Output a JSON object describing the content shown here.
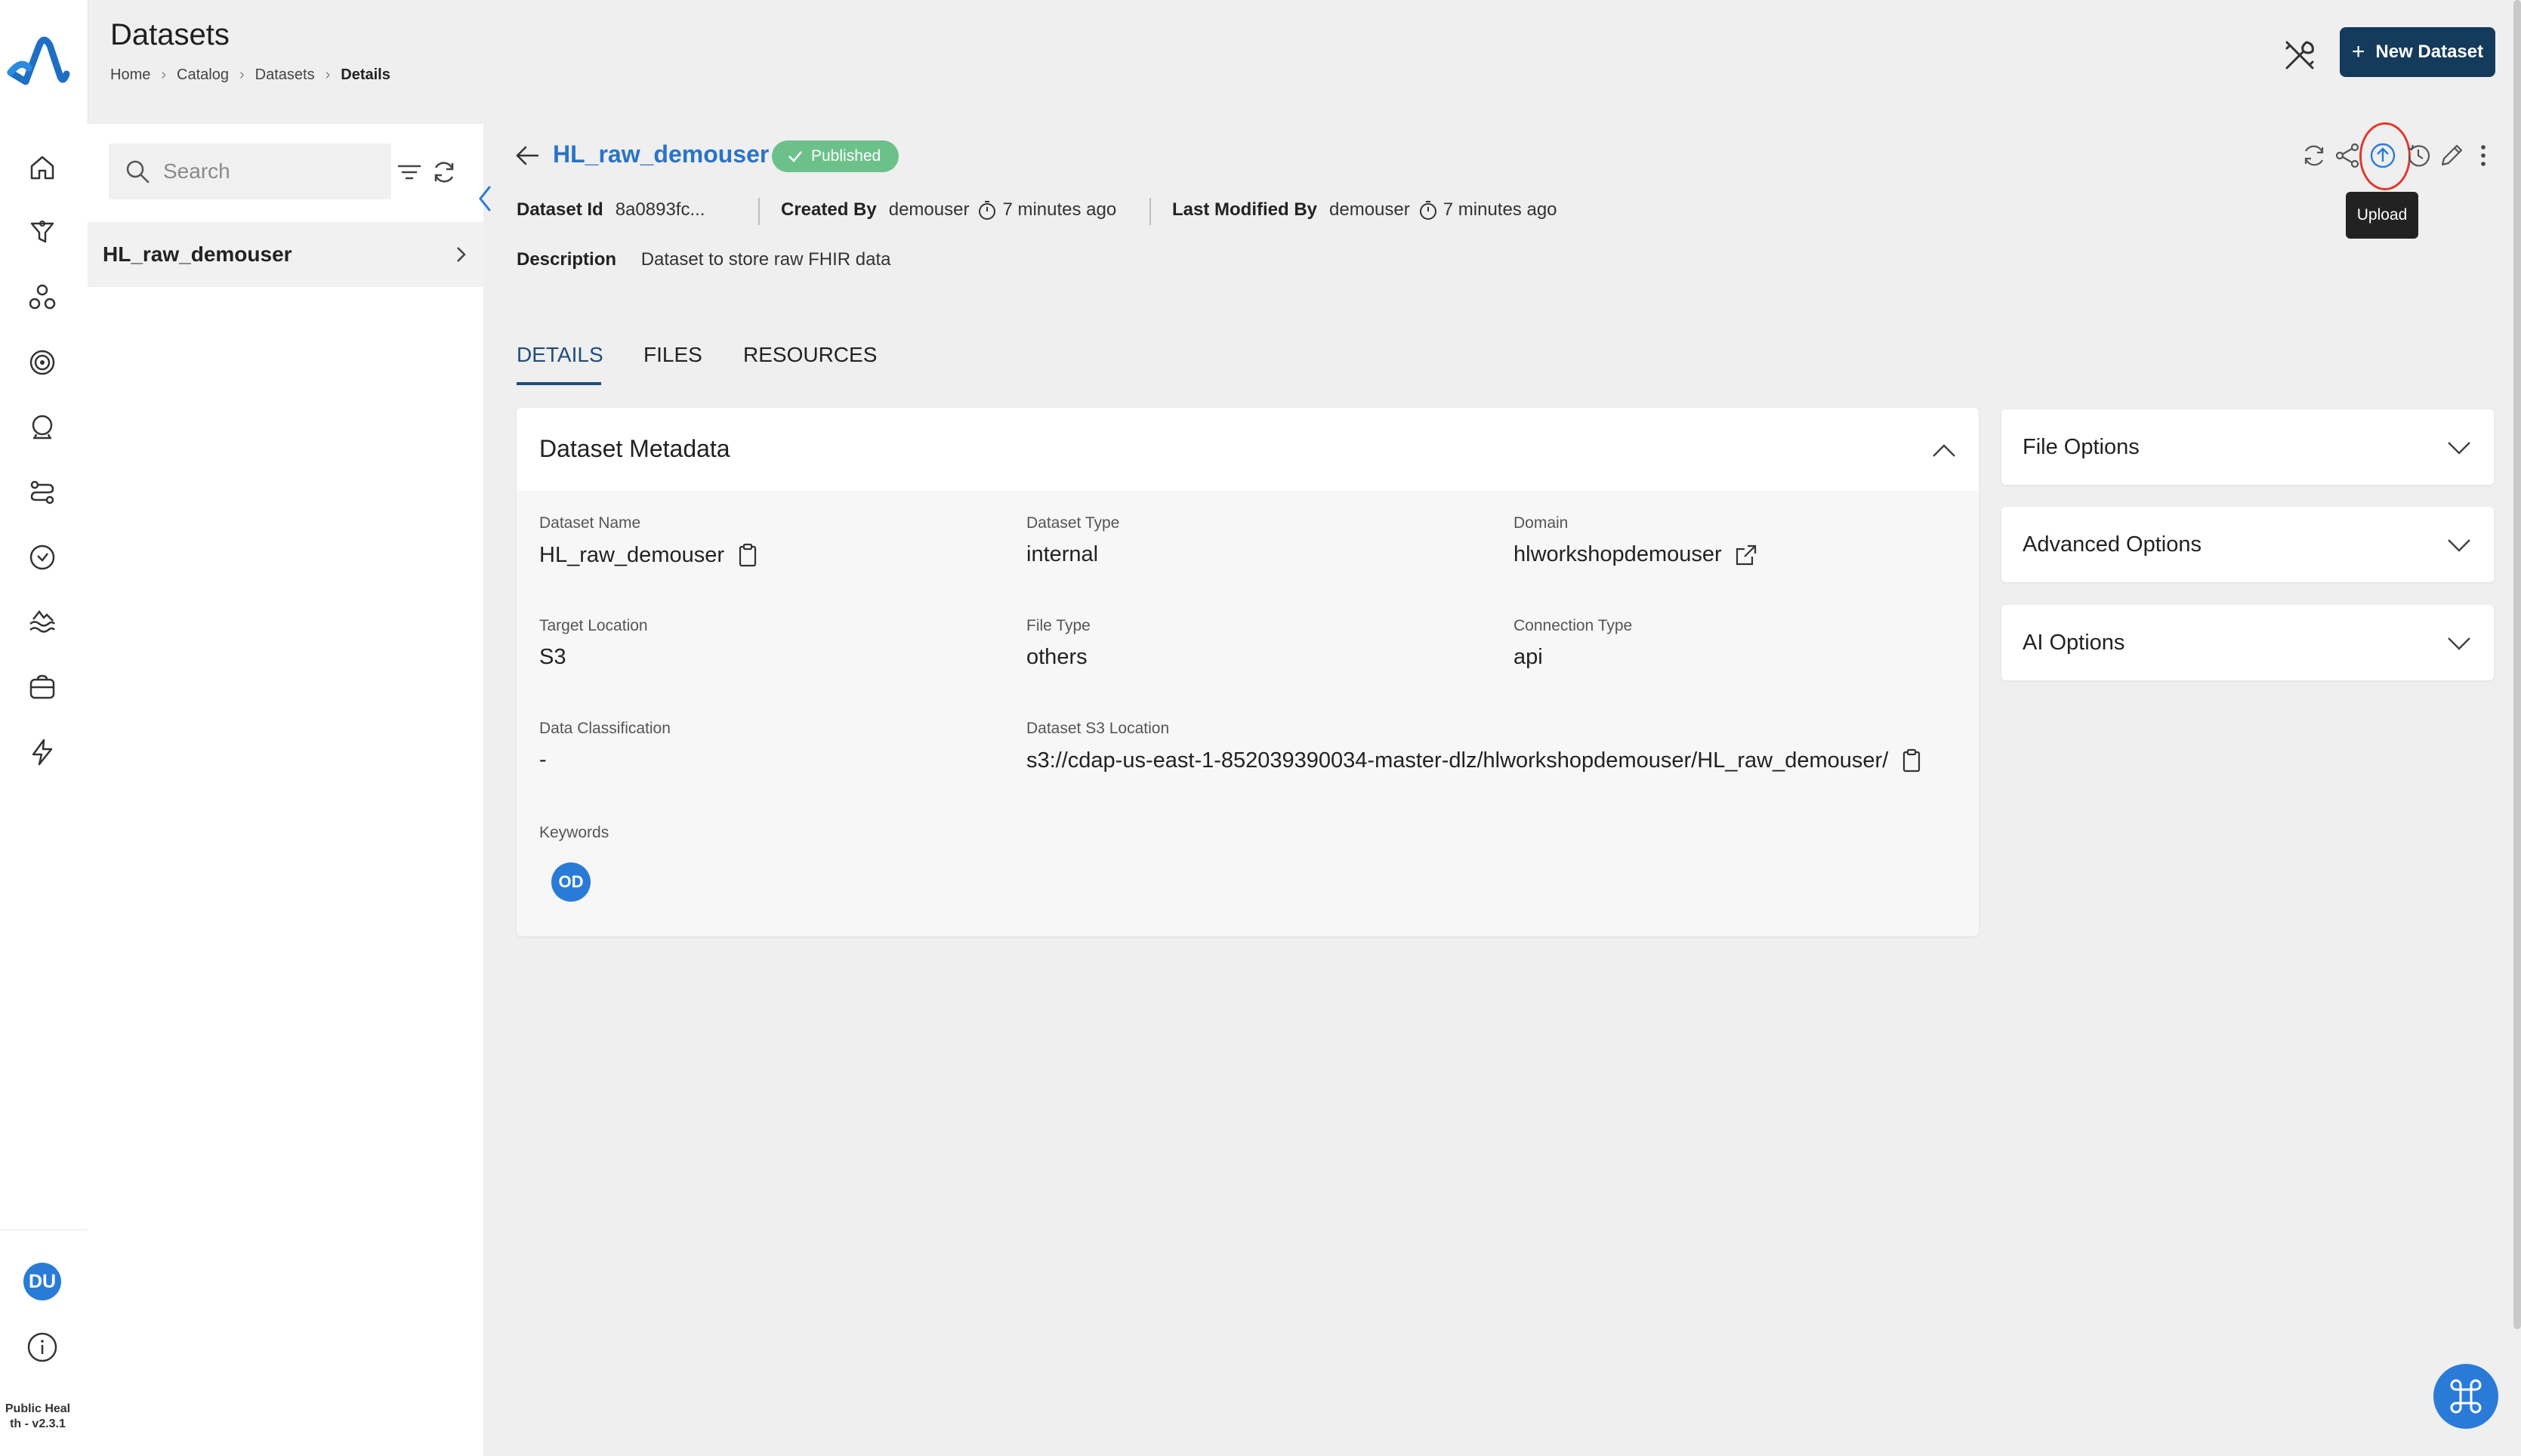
{
  "header": {
    "title": "Datasets",
    "breadcrumbs": [
      "Home",
      "Catalog",
      "Datasets",
      "Details"
    ],
    "new_button_label": "New Dataset"
  },
  "sidebar": {
    "avatar_initials": "DU",
    "version_line1": "Public Heal",
    "version_line2": "th - v2.3.1",
    "nav_icons": [
      "home-icon",
      "funnel-icon",
      "group-icon",
      "target-icon",
      "crystal-ball-icon",
      "pipeline-icon",
      "clock-icon",
      "lake-icon",
      "storage-icon",
      "bolt-icon"
    ]
  },
  "dataset_list": {
    "search_placeholder": "Search",
    "items": [
      {
        "label": "HL_raw_demouser"
      }
    ]
  },
  "dataset": {
    "name": "HL_raw_demouser",
    "status": "Published",
    "id_label": "Dataset Id",
    "id_value": "8a0893fc...",
    "created_by_label": "Created By",
    "created_by": "demouser",
    "created_time": "7 minutes ago",
    "modified_by_label": "Last Modified By",
    "modified_by": "demouser",
    "modified_time": "7 minutes ago",
    "description_label": "Description",
    "description": "Dataset to store raw FHIR data"
  },
  "actions": {
    "tooltip": "Upload",
    "icons": [
      "sync-icon",
      "share-icon",
      "upload-icon",
      "history-icon",
      "edit-icon",
      "more-vertical-icon"
    ]
  },
  "tabs": [
    "DETAILS",
    "FILES",
    "RESOURCES"
  ],
  "metadata": {
    "title": "Dataset Metadata",
    "fields": {
      "dataset_name": {
        "label": "Dataset Name",
        "value": "HL_raw_demouser"
      },
      "dataset_type": {
        "label": "Dataset Type",
        "value": "internal"
      },
      "domain": {
        "label": "Domain",
        "value": "hlworkshopdemouser"
      },
      "target_location": {
        "label": "Target Location",
        "value": "S3"
      },
      "file_type": {
        "label": "File Type",
        "value": "others"
      },
      "connection_type": {
        "label": "Connection Type",
        "value": "api"
      },
      "data_classification": {
        "label": "Data Classification",
        "value": "-"
      },
      "s3_location": {
        "label": "Dataset S3 Location",
        "value": "s3://cdap-us-east-1-852039390034-master-dlz/hlworkshopdemouser/HL_raw_demouser/"
      },
      "keywords": {
        "label": "Keywords",
        "values": [
          "OD"
        ]
      }
    }
  },
  "accordions": [
    "File Options",
    "Advanced Options",
    "AI Options"
  ],
  "colors": {
    "accent": "#2a7bd8",
    "primary_button": "#143a5c",
    "published": "#6cc18b",
    "link": "#2a73c9",
    "highlight_ring": "#e0392d"
  }
}
